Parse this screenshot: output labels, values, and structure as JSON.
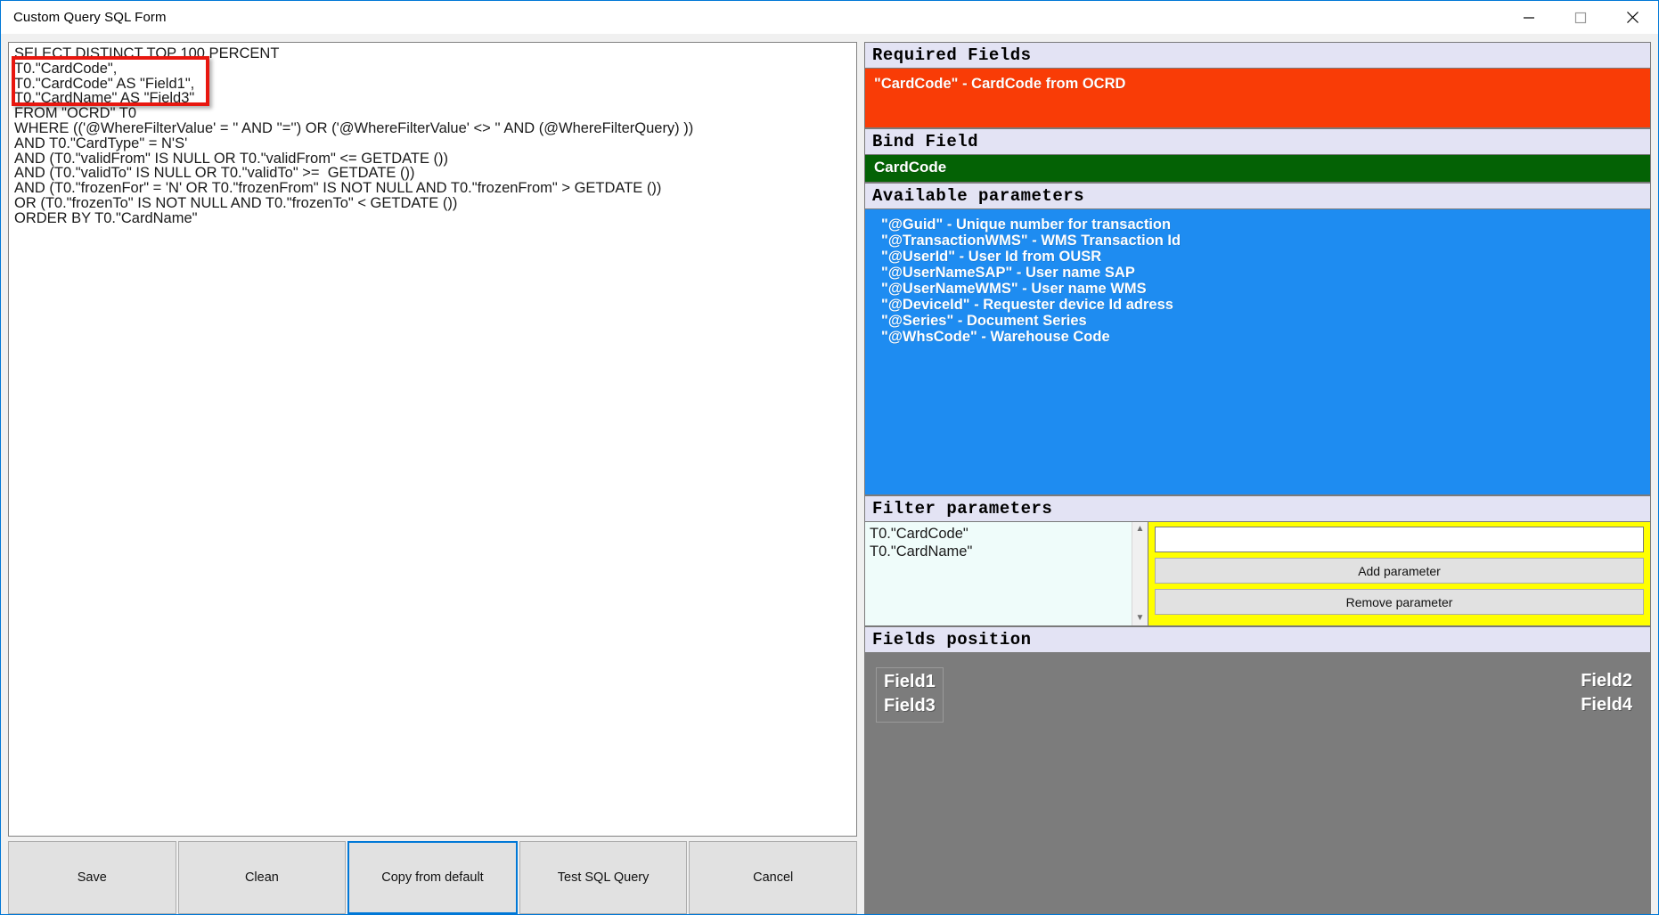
{
  "window": {
    "title": "Custom Query SQL Form",
    "controls": {
      "minimize": "minimize-icon",
      "maximize": "maximize-icon",
      "close": "close-icon"
    }
  },
  "sql_editor": {
    "lines": [
      "SELECT DISTINCT TOP 100 PERCENT",
      "T0.\"CardCode\",",
      "T0.\"CardCode\" AS \"Field1\",",
      "T0.\"CardName\" AS \"Field3\"",
      "FROM \"OCRD\" T0",
      "WHERE (('@WhereFilterValue' = '' AND ''='') OR ('@WhereFilterValue' <> '' AND (@WhereFilterQuery) ))",
      "AND T0.\"CardType\" = N'S'",
      "AND (T0.\"validFrom\" IS NULL OR T0.\"validFrom\" <= GETDATE ())",
      "AND (T0.\"validTo\" IS NULL OR T0.\"validTo\" >=  GETDATE ())",
      "AND (T0.\"frozenFor\" = 'N' OR T0.\"frozenFrom\" IS NOT NULL AND T0.\"frozenFrom\" > GETDATE ())",
      "OR (T0.\"frozenTo\" IS NOT NULL AND T0.\"frozenTo\" < GETDATE ())",
      "ORDER BY T0.\"CardName\""
    ],
    "highlight_color": "#e8170f"
  },
  "bottom_buttons": [
    {
      "label": "Save",
      "focused": false
    },
    {
      "label": "Clean",
      "focused": false
    },
    {
      "label": "Copy from default",
      "focused": true
    },
    {
      "label": "Test SQL Query",
      "focused": false
    },
    {
      "label": "Cancel",
      "focused": false
    }
  ],
  "required_fields": {
    "header": "Required Fields",
    "bg_color": "#f93c06",
    "items": [
      "\"CardCode\" - CardCode from OCRD"
    ]
  },
  "bind_field": {
    "header": "Bind Field",
    "bg_color": "#046205",
    "value": "CardCode"
  },
  "available_parameters": {
    "header": "Available parameters",
    "bg_color": "#1e8cf1",
    "items": [
      "\"@Guid\" - Unique number for transaction",
      "\"@TransactionWMS\" - WMS Transaction Id",
      "\"@UserId\" - User Id from OUSR",
      "\"@UserNameSAP\" - User name SAP",
      "\"@UserNameWMS\" - User name WMS",
      "\"@DeviceId\" - Requester device Id adress",
      "\"@Series\" - Document Series",
      "\"@WhsCode\" - Warehouse Code"
    ]
  },
  "filter_parameters": {
    "header": "Filter parameters",
    "panel_color": "#ffff00",
    "items": [
      "T0.\"CardCode\"",
      "T0.\"CardName\""
    ],
    "input_value": "",
    "input_placeholder": "",
    "add_label": "Add parameter",
    "remove_label": "Remove parameter",
    "scroll_up_icon": "chevron-up-icon",
    "scroll_down_icon": "chevron-down-icon"
  },
  "fields_position": {
    "header": "Fields position",
    "bg_color": "#7c7c7c",
    "left": [
      "Field1",
      "Field3"
    ],
    "right": [
      "Field2",
      "Field4"
    ]
  }
}
